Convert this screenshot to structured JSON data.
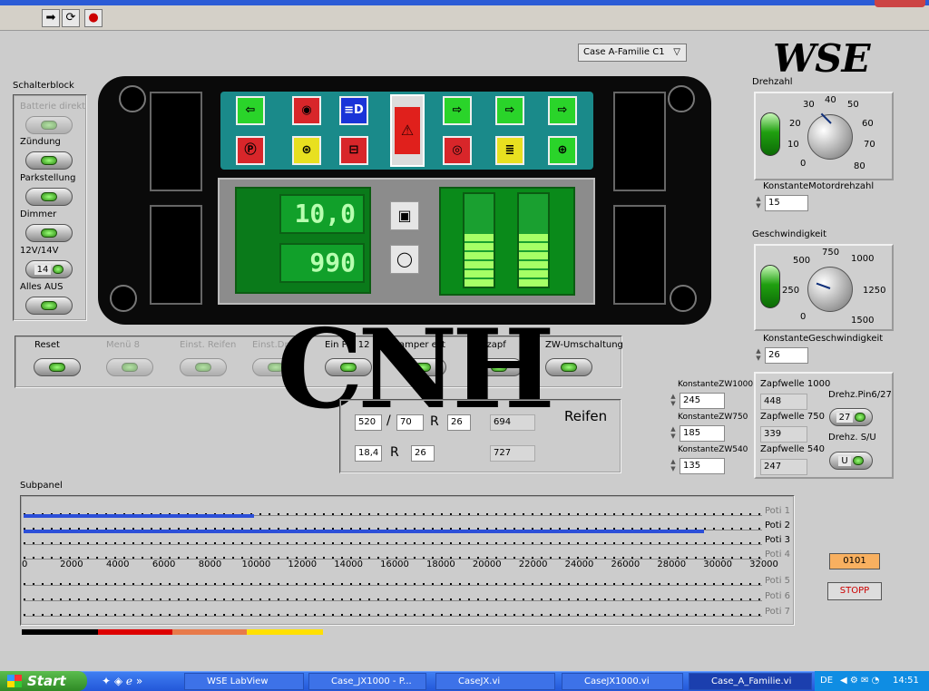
{
  "toolbar": {
    "buttons": [
      {
        "name": "run-arrow-icon",
        "glyph": "➡"
      },
      {
        "name": "run-continuously-icon",
        "glyph": "⟳"
      },
      {
        "name": "abort-icon",
        "glyph": "●"
      }
    ]
  },
  "dropdown": {
    "value": "Case A-Familie C1"
  },
  "logo": {
    "wse": "WSE",
    "cnh": "CNH"
  },
  "schalterblock": {
    "title": "Schalterblock",
    "items": [
      {
        "label": "Batterie direkt",
        "disabled": true
      },
      {
        "label": "Zündung"
      },
      {
        "label": "Parkstellung"
      },
      {
        "label": "Dimmer"
      },
      {
        "label": "12V/14V",
        "value": "14"
      },
      {
        "label": "Alles AUS"
      }
    ]
  },
  "display": {
    "lcd1": "10,0",
    "lcd2": "990"
  },
  "bars": {
    "bar1_segments": 6,
    "bar2_segments": 6
  },
  "functions": {
    "items": [
      {
        "label": "Reset",
        "disabled": false
      },
      {
        "label": "Menü 8",
        "disabled": true
      },
      {
        "label": "Einst. Reifen",
        "disabled": true
      },
      {
        "label": "Einst.Dre",
        "disabled": true
      },
      {
        "label": "Ein Pin 12",
        "disabled": false
      },
      {
        "label": "amper est",
        "disabled": false
      },
      {
        "label": "egzapf",
        "disabled": false
      },
      {
        "label": "ZW-Umschaltung",
        "disabled": false
      }
    ]
  },
  "reifen": {
    "title": "Reifen",
    "row1": {
      "width": "520",
      "slash": "/",
      "ratio": "70",
      "r": "R",
      "rim": "26",
      "result": "694"
    },
    "row2": {
      "width": "18,4",
      "r": "R",
      "rim": "26",
      "result": "727"
    }
  },
  "drehzahl": {
    "title": "Drehzahl",
    "scale": [
      "0",
      "10",
      "20",
      "30",
      "40",
      "50",
      "60",
      "70",
      "80"
    ],
    "const_label": "KonstanteMotordrehzahl",
    "const_value": "15"
  },
  "geschwindigkeit": {
    "title": "Geschwindigkeit",
    "scale": [
      "0",
      "250",
      "500",
      "750",
      "1000",
      "1250",
      "1500"
    ],
    "const_label": "KonstanteGeschwindigkeit",
    "const_value": "26"
  },
  "zw": {
    "zw1000_label": "KonstanteZW1000",
    "zw1000_value": "245",
    "zw750_label": "KonstanteZW750",
    "zw750_value": "185",
    "zw540_label": "KonstanteZW540",
    "zw540_value": "135"
  },
  "zapfwelle": {
    "z1000_label": "Zapfwelle 1000",
    "z1000_value": "448",
    "z750_label": "Zapfwelle 750",
    "z750_value": "339",
    "z540_label": "Zapfwelle 540",
    "z540_value": "247",
    "pin_label": "Drehz.Pin6/27",
    "pin_value": "27",
    "su_label": "Drehz. S/U",
    "su_value": "U"
  },
  "subpanel": {
    "title": "Subpanel",
    "potis": [
      "Poti 1",
      "Poti 2",
      "Poti 3",
      "Poti 4",
      "Poti 5",
      "Poti 6",
      "Poti 7"
    ],
    "scale": [
      "0",
      "2000",
      "4000",
      "6000",
      "8000",
      "10000",
      "12000",
      "14000",
      "16000",
      "18000",
      "20000",
      "22000",
      "24000",
      "26000",
      "28000",
      "30000",
      "32000"
    ],
    "poti1_value": 10000,
    "poti2_value": 29500,
    "max": 32000
  },
  "status": {
    "code": "0101",
    "stop": "STOPP"
  },
  "taskbar": {
    "start": "Start",
    "tasks": [
      "WSE LabView",
      "Case_JX1000 - P...",
      "CaseJX.vi",
      "CaseJX1000.vi",
      "Case_A_Familie.vi"
    ],
    "lang": "DE",
    "time": "14:51"
  }
}
